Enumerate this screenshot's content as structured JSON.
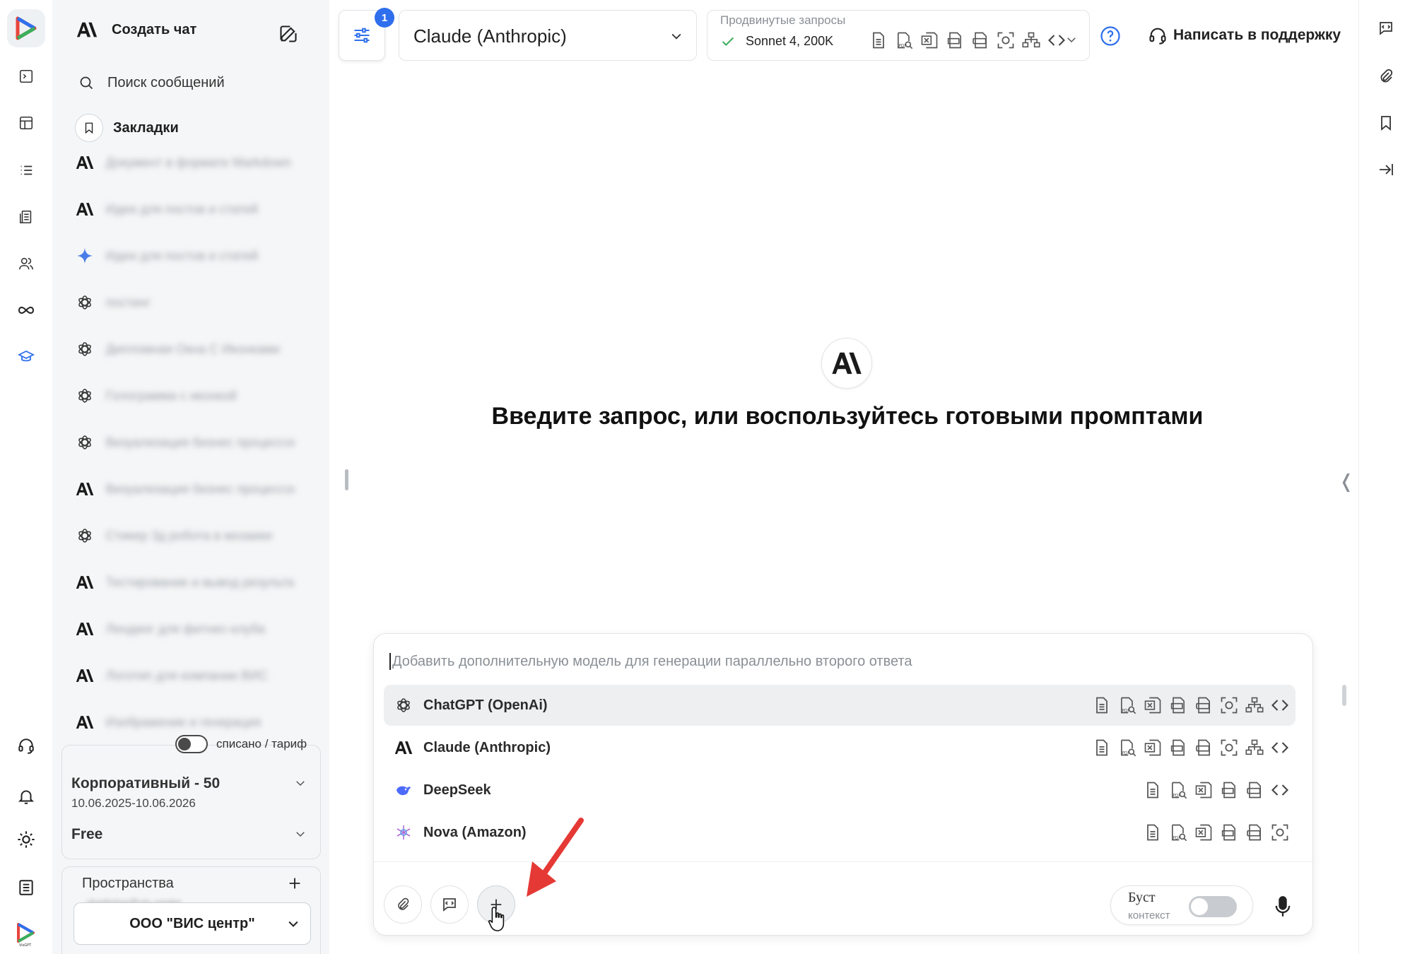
{
  "sidebar": {
    "new_chat": "Создать чат",
    "search": "Поиск сообщений",
    "bookmarks": "Закладки",
    "chats": [
      {
        "icon": "anthropic-icon",
        "text": "Документ в формате Markdown"
      },
      {
        "icon": "anthropic-icon",
        "text": "Идеи для постов и статей"
      },
      {
        "icon": "gemini-icon",
        "text": "Идеи для постов и статей"
      },
      {
        "icon": "openai-icon",
        "text": "постинг"
      },
      {
        "icon": "openai-icon",
        "text": "Дипломная Окна С Иконками"
      },
      {
        "icon": "openai-icon",
        "text": "Голограмма с иконкой"
      },
      {
        "icon": "openai-icon",
        "text": "Визуализация бизнес процессов"
      },
      {
        "icon": "anthropic-icon",
        "text": "Визуализация бизнес процессов"
      },
      {
        "icon": "openai-icon",
        "text": "Стикер 3д робота в мозаике"
      },
      {
        "icon": "anthropic-icon",
        "text": "Тестирование и вывод результатов"
      },
      {
        "icon": "anthropic-icon",
        "text": "Лендинг для фитнес-клуба"
      },
      {
        "icon": "anthropic-icon",
        "text": "Логотип для компании ВИС"
      },
      {
        "icon": "anthropic-icon",
        "text": "Изображение и генерация"
      }
    ],
    "toggle_label": "списано / тариф",
    "plan_name": "Корпоративный - 50",
    "plan_dates": "10.06.2025-10.06.2026",
    "plan_tier": "Free",
    "spaces_title": "Пространства",
    "spaces_email": "vkadmina@vis-center",
    "org": "ООО \"ВИС центр\""
  },
  "topbar": {
    "filter_badge": "1",
    "model_selected": "Claude (Anthropic)",
    "advanced_label": "Продвинутые запросы",
    "advanced_value": "Sonnet 4, 200K",
    "support": "Написать в поддержку"
  },
  "main": {
    "hero_text": "Введите запрос, или воспользуйтесь готовыми промптами"
  },
  "composer": {
    "placeholder": "Добавить дополнительную модель для генерации параллельно второго ответа",
    "models": [
      {
        "name": "ChatGPT (OpenAi)",
        "icon": "openai-icon",
        "features": [
          "doc",
          "pdf",
          "xls",
          "txt",
          "docx",
          "scan",
          "tree",
          "code"
        ],
        "highlighted": true
      },
      {
        "name": "Claude (Anthropic)",
        "icon": "anthropic-icon",
        "features": [
          "doc",
          "pdf",
          "xls",
          "txt",
          "docx",
          "scan",
          "tree",
          "code"
        ],
        "highlighted": false
      },
      {
        "name": "DeepSeek",
        "icon": "deepseek-icon",
        "features": [
          "doc",
          "pdf",
          "xls",
          "txt",
          "docx",
          "code"
        ],
        "highlighted": false
      },
      {
        "name": "Nova (Amazon)",
        "icon": "nova-icon",
        "features": [
          "doc",
          "pdf",
          "xls",
          "txt",
          "docx",
          "scan"
        ],
        "highlighted": false
      }
    ],
    "boost_label": "Буст",
    "boost_sub": "контекст"
  },
  "colors": {
    "accent": "#2f6fed",
    "arrow": "#e53935",
    "check": "#3cae5c"
  }
}
